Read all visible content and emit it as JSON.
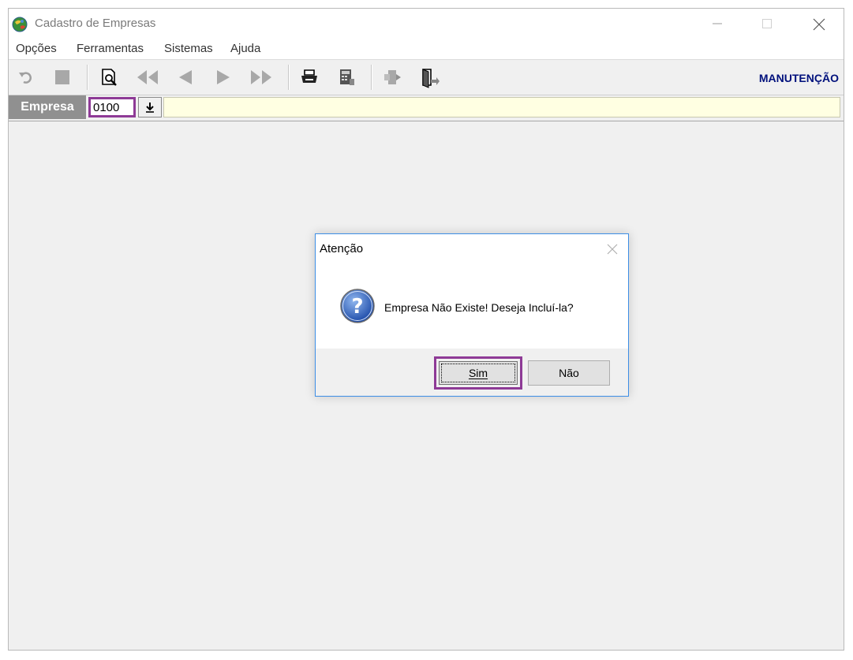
{
  "window": {
    "title": "Cadastro de Empresas"
  },
  "menu": [
    "Opções",
    "Ferramentas",
    "Sistemas",
    "Ajuda"
  ],
  "toolbar": {
    "icons": [
      "undo-icon",
      "stop-icon",
      "preview-icon",
      "first-record-icon",
      "previous-record-icon",
      "next-record-icon",
      "last-record-icon",
      "print-icon",
      "calculator-icon",
      "export-icon",
      "exit-door-icon"
    ],
    "mode_label": "MANUTENÇÃO"
  },
  "field": {
    "label": "Empresa",
    "value": "0100",
    "description": ""
  },
  "dialog": {
    "title": "Atenção",
    "message": "Empresa Não Existe! Deseja Incluí-la?",
    "icon": "question-icon",
    "yes_label": "Sim",
    "no_label": "Não"
  },
  "colors": {
    "highlight": "#8e3a96",
    "mode_label": "#00107c",
    "field_label_bg": "#909090",
    "description_bg": "#ffffe2",
    "dialog_border": "#3d8ee6"
  }
}
